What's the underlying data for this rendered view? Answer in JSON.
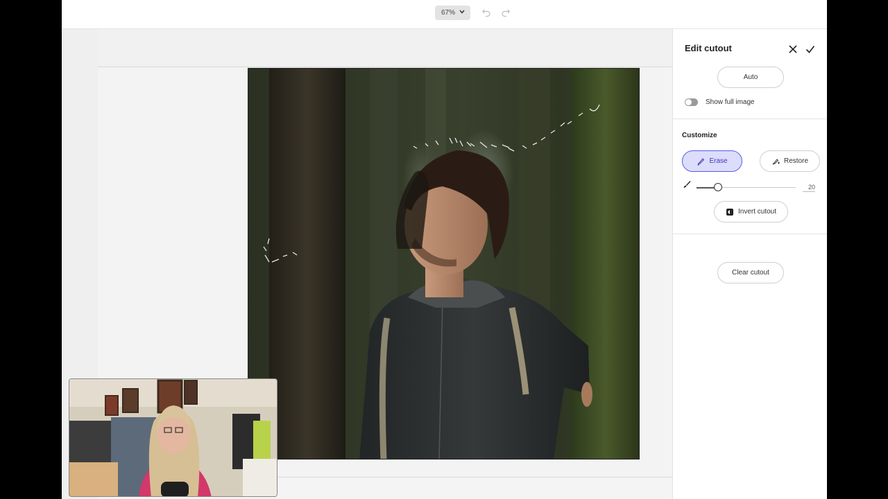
{
  "toolbar": {
    "zoom_label": "67%",
    "icons": [
      "chevron-down-icon",
      "undo-icon",
      "redo-icon"
    ]
  },
  "panel": {
    "title": "Edit cutout",
    "auto_label": "Auto",
    "show_full_image_label": "Show full image",
    "show_full_image_on": false,
    "customize_label": "Customize",
    "erase_label": "Erase",
    "restore_label": "Restore",
    "brush_size": "20",
    "invert_label": "Invert cutout",
    "clear_label": "Clear cutout",
    "active_tool": "Erase"
  },
  "colors": {
    "accent": "#5c5ce0",
    "accent_fill": "#dcdcfb",
    "panel_bg": "#ffffff",
    "canvas_bg": "#f3f3f3"
  }
}
